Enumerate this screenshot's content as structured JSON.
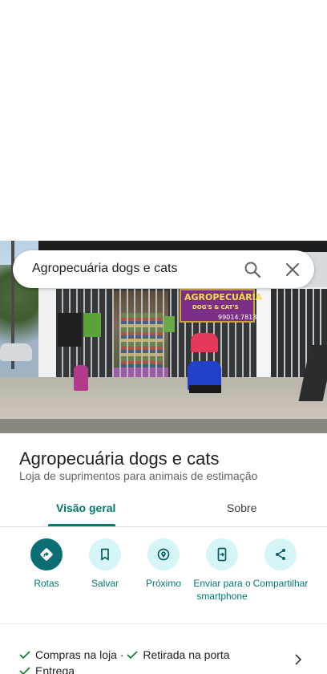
{
  "search": {
    "value": "Agropecuária dogs e cats"
  },
  "photo": {
    "sign_line1": "AGROPECUÁRIA",
    "sign_line2": "DOG'S & CAT'S",
    "sign_line3": "99014.7813"
  },
  "place": {
    "title": "Agropecuária dogs e cats",
    "category": "Loja de suprimentos para animais de estimação"
  },
  "tabs": [
    {
      "label": "Visão geral",
      "active": true
    },
    {
      "label": "Sobre",
      "active": false
    }
  ],
  "actions": [
    {
      "label": "Rotas",
      "icon": "directions-icon"
    },
    {
      "label": "Salvar",
      "icon": "bookmark-icon"
    },
    {
      "label": "Próximo",
      "icon": "nearby-icon"
    },
    {
      "label": "Enviar para o smartphone",
      "icon": "send-to-phone-icon"
    },
    {
      "label": "Compartilhar",
      "icon": "share-icon"
    }
  ],
  "services": {
    "item1": "Compras na loja",
    "separator": "·",
    "item2": "Retirada na porta",
    "item3": "Entrega"
  },
  "colors": {
    "accent": "#00796b",
    "action_bg": "#d6f5f7",
    "action_primary_bg": "#0b6e72",
    "check": "#188038"
  }
}
